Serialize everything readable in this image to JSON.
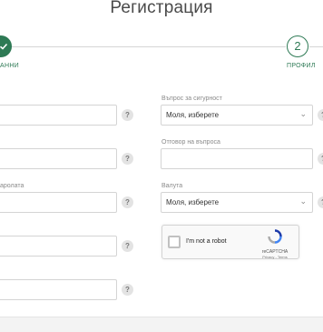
{
  "page": {
    "title": "Регистрация"
  },
  "steps": [
    {
      "number": "",
      "label": "АННИ"
    },
    {
      "number": "2",
      "label": "ПРОФИЛ"
    }
  ],
  "form": {
    "password_label_partial": "аролата",
    "security_question_label": "Въпрос за сигурност",
    "security_question_value": "Моля, изберете",
    "answer_label": "Отговор на въпроса",
    "currency_label": "Валута",
    "currency_value": "Моля, изберете",
    "help_symbol": "?"
  },
  "recaptcha": {
    "checkbox_label": "I'm not a robot",
    "brand": "reCAPTCHA",
    "links": "Privacy - Terms"
  },
  "colors": {
    "accent": "#2e7a55"
  }
}
